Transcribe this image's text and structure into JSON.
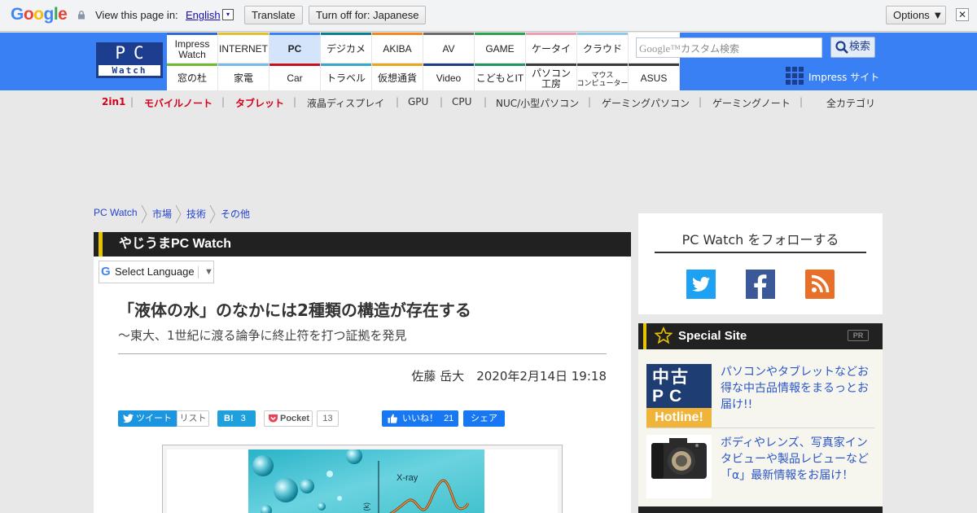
{
  "translate_bar": {
    "logo_text": "Google",
    "view_label": "View this page in:",
    "language": "English",
    "dropdown_glyph": "▾",
    "translate_label": "Translate",
    "turn_off_label": "Turn off for: Japanese",
    "options_label": "Options ▼",
    "close_glyph": "✕"
  },
  "header": {
    "logo_top": "PC",
    "logo_bottom": "Watch",
    "nav_row1": [
      {
        "label": "Impress\nWatch",
        "color": "#2d6ad5"
      },
      {
        "label": "INTERNET",
        "color": "#e2c12e"
      },
      {
        "label": "PC",
        "color": "#3a80f5"
      },
      {
        "label": "デジカメ",
        "color": "#0d7e8e"
      },
      {
        "label": "AKIBA",
        "color": "#ef8a1f"
      },
      {
        "label": "AV",
        "color": "#6a6a6a"
      },
      {
        "label": "GAME",
        "color": "#29a34c"
      },
      {
        "label": "ケータイ",
        "color": "#eb9fb5"
      },
      {
        "label": "クラウド",
        "color": "#8dcae9"
      }
    ],
    "nav_row2": [
      {
        "label": "窓の杜",
        "color": "#6fbb2d"
      },
      {
        "label": "家電",
        "color": "#79bbe8"
      },
      {
        "label": "Car",
        "color": "#c3111f"
      },
      {
        "label": "トラベル",
        "color": "#3aa9c8"
      },
      {
        "label": "仮想通貨",
        "color": "#e7a820"
      },
      {
        "label": "Video",
        "color": "#1f3c86"
      },
      {
        "label": "こどもとIT",
        "color": "#24955e"
      },
      {
        "label": "パソコン\n工房",
        "color": "#3a3a3a"
      },
      {
        "label": "マウス\nコンピューター",
        "color": "#3a3a3a"
      },
      {
        "label": "ASUS",
        "color": "#3a3a3a"
      }
    ],
    "search_placeholder_brand": "Google™",
    "search_placeholder": "カスタム検索",
    "search_button": "検索",
    "impress_site": "Impress サイト"
  },
  "categories": [
    {
      "label": "2in1",
      "highlight": true
    },
    {
      "label": "モバイルノート",
      "highlight": true
    },
    {
      "label": "タブレット",
      "highlight": true
    },
    {
      "label": "液晶ディスプレイ",
      "highlight": false
    },
    {
      "label": "GPU",
      "highlight": false
    },
    {
      "label": "CPU",
      "highlight": false
    },
    {
      "label": "NUC/小型パソコン",
      "highlight": false
    },
    {
      "label": "ゲーミングパソコン",
      "highlight": false
    },
    {
      "label": "ゲーミングノート",
      "highlight": false
    }
  ],
  "all_categories": "全カテゴリ",
  "breadcrumb": [
    "PC Watch",
    "市場",
    "技術",
    "その他"
  ],
  "section_title": "やじうまPC Watch",
  "select_language": "Select Language",
  "article": {
    "title": "「液体の水」のなかには2種類の構造が存在する",
    "subtitle": "～東大、1世紀に渡る論争に終止符を打つ証拠を発見",
    "author": "佐藤 岳大",
    "date": "2020年2月14日 19:18",
    "figure_label": "X-ray",
    "figure_axis": "S (k)"
  },
  "share": {
    "tweet": "ツイート",
    "list": "リスト",
    "hatena": "B!",
    "hatena_count": "3",
    "pocket": "Pocket",
    "pocket_count": "13",
    "like": "いいね！",
    "like_count": "21",
    "fb_share": "シェア"
  },
  "sidebar": {
    "follow_title": "PC Watch をフォローする",
    "special_title": "Special Site",
    "pr_badge": "PR",
    "specials": [
      {
        "text": "パソコンやタブレットなどお得な中古品情報をまるっとお届け!!",
        "thumb_lines": [
          "中古",
          "PC",
          "Hotline!"
        ]
      },
      {
        "text": "ボディやレンズ、写真家インタビューや製品レビューなど「α」最新情報をお届け！"
      }
    ]
  }
}
